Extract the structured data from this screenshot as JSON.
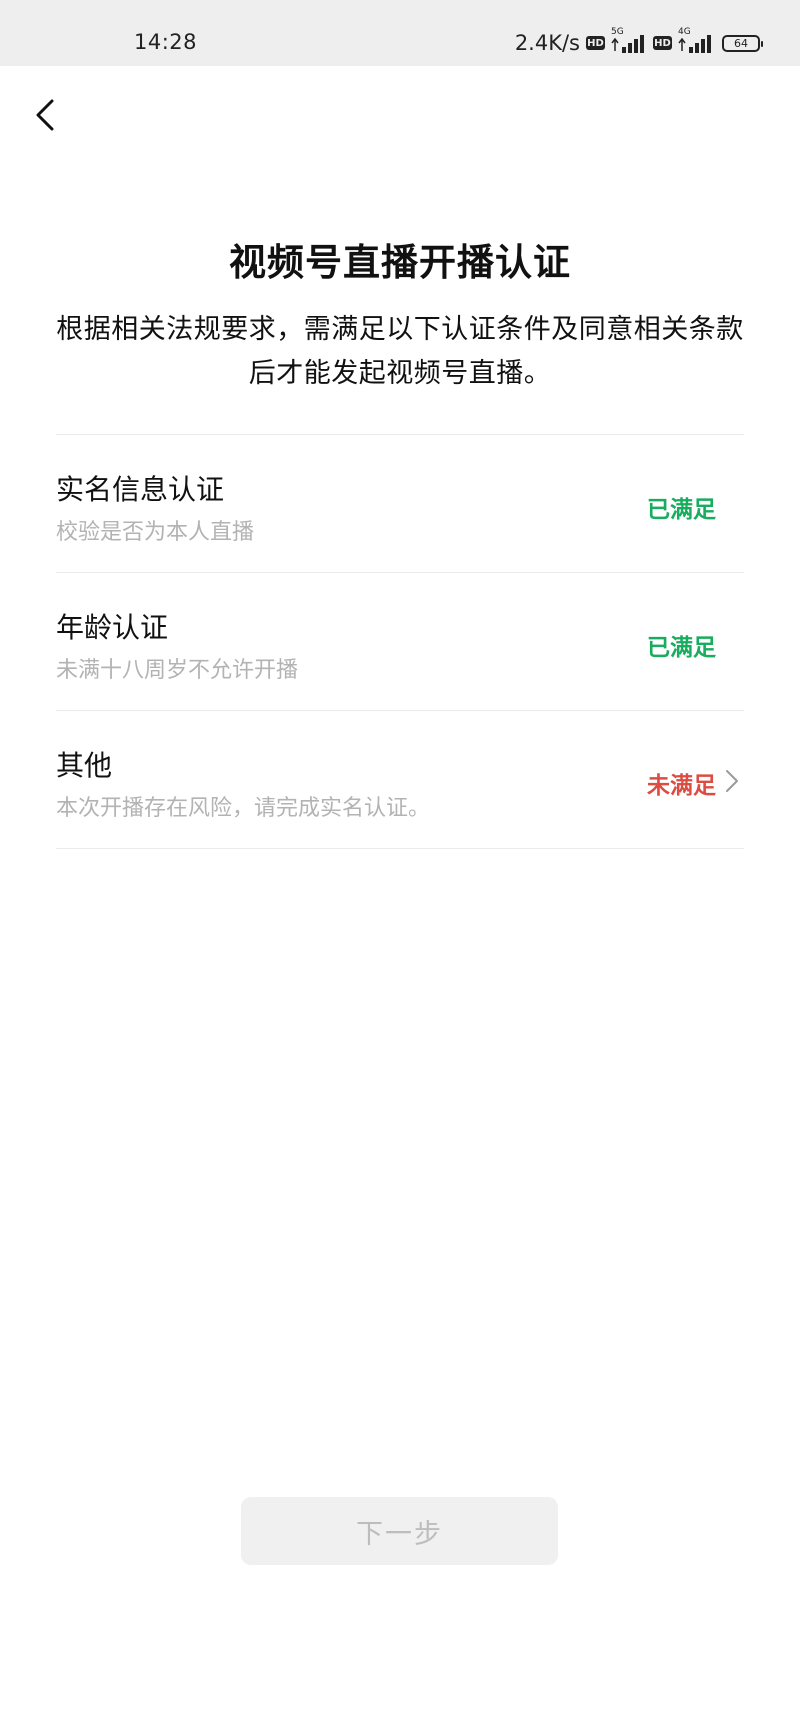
{
  "status_bar": {
    "time": "14:28",
    "net_speed": "2.4K/s",
    "hd_label": "HD",
    "sim1_tag": "5G",
    "sim2_tag": "4G",
    "battery": "64"
  },
  "header": {
    "title": "视频号直播开播认证",
    "description": "根据相关法规要求，需满足以下认证条件及同意相关条款后才能发起视频号直播。"
  },
  "requirements": [
    {
      "title": "实名信息认证",
      "desc": "校验是否为本人直播",
      "status": "已满足",
      "state": "ok"
    },
    {
      "title": "年龄认证",
      "desc": "未满十八周岁不允许开播",
      "status": "已满足",
      "state": "ok"
    },
    {
      "title": "其他",
      "desc": "本次开播存在风险，请完成实名认证。",
      "status": "未满足",
      "state": "fail"
    }
  ],
  "footer": {
    "next_label": "下一步",
    "next_enabled": false
  },
  "colors": {
    "ok": "#18ad5e",
    "fail": "#dd4c43",
    "muted_text": "#b3b3b3",
    "status_bar_bg": "#eeeeee"
  },
  "icons": {
    "back": "chevron-left-icon",
    "row_arrow": "chevron-right-icon"
  }
}
